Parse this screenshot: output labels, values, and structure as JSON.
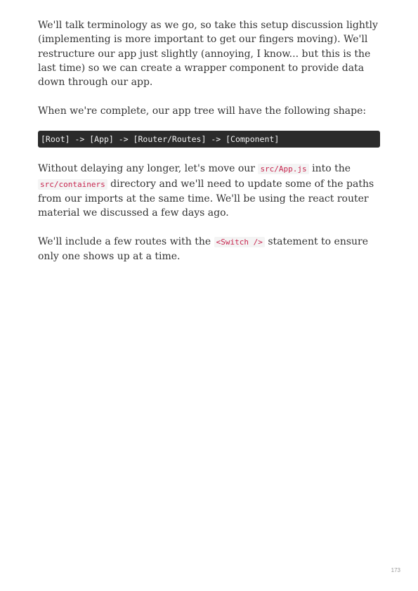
{
  "paragraphs": {
    "p1": "We'll talk terminology as we go, so take this setup discussion lightly (implementing is more important to get our fingers moving). We'll restructure our app just slightly (annoying, I know... but this is the last time) so we can create a wrapper component to provide data down through our app.",
    "p2": "When we're complete, our app tree will have the following shape:",
    "p3": {
      "before": "Without delaying any longer, let's move our ",
      "code1": "src/App.js",
      "middle": " into the ",
      "code2": "src/containers",
      "after": " directory and we'll need to update some of the paths from our imports at the same time. We'll be using the react router material we discussed a few days ago."
    },
    "p4": {
      "before": "We'll include a few routes with the ",
      "code": "<Switch />",
      "after": " statement to ensure only one shows up at a time."
    }
  },
  "code_block": "[Root] -> [App] -> [Router/Routes] -> [Component]",
  "page_number": "173"
}
